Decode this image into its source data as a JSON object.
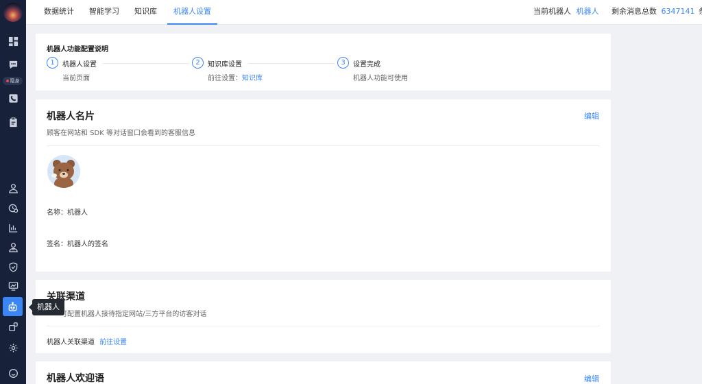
{
  "sidebar": {
    "stealth_badge": "隐身",
    "tooltip": "机器人",
    "icons": [
      "dashboard-icon",
      "chat-icon",
      "call-icon",
      "ticket-icon",
      "contact-icon",
      "history-icon",
      "stats-icon",
      "team-icon",
      "security-icon",
      "monitor-icon",
      "robot-icon",
      "plugin-icon",
      "settings-icon",
      "help-icon"
    ]
  },
  "topbar": {
    "tabs": [
      {
        "label": "数据统计",
        "active": false
      },
      {
        "label": "智能学习",
        "active": false
      },
      {
        "label": "知识库",
        "active": false
      },
      {
        "label": "机器人设置",
        "active": true
      }
    ],
    "current_robot_label": "当前机器人",
    "current_robot_value": "机器人",
    "remaining_label": "剩余消息总数",
    "remaining_value": "6347141",
    "remaining_unit": "条"
  },
  "config": {
    "title": "机器人功能配置说明",
    "steps": [
      {
        "num": "1",
        "label": "机器人设置",
        "desc": "当前页面",
        "link": ""
      },
      {
        "num": "2",
        "label": "知识库设置",
        "desc": "前往设置：",
        "link": "知识库"
      },
      {
        "num": "3",
        "label": "设置完成",
        "desc": "机器人功能可使用",
        "link": ""
      }
    ]
  },
  "card_profile": {
    "title": "机器人名片",
    "edit": "编辑",
    "subtitle": "顾客在网站和 SDK 等对话窗口会看到的客服信息",
    "name_line": "名称：机器人",
    "signature_line": "签名：机器人的签名"
  },
  "card_channel": {
    "title": "关联渠道",
    "subtitle": "可配置机器人接待指定网站/三方平台的访客对话",
    "row_label": "机器人关联渠道",
    "row_link": "前往设置"
  },
  "card_welcome": {
    "title": "机器人欢迎语",
    "edit": "编辑"
  },
  "colors": {
    "accent": "#3b86f5",
    "sidebar_bg": "#17213a",
    "page_bg": "#f0f1f4"
  }
}
